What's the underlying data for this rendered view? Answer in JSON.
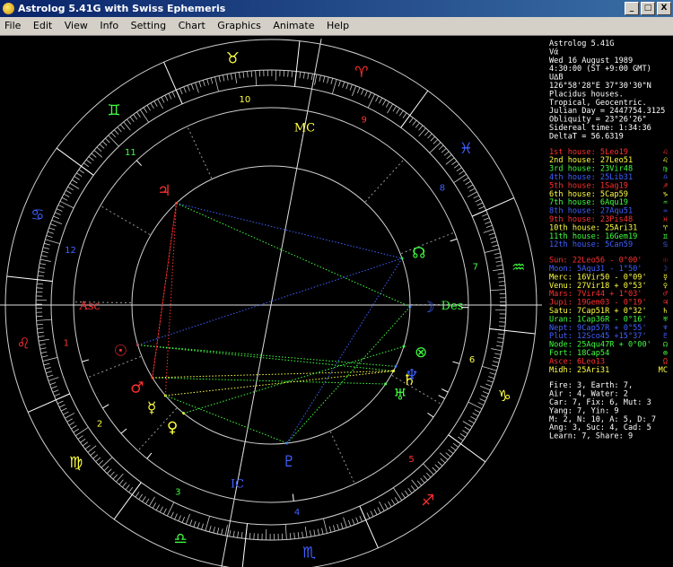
{
  "window": {
    "title": "Astrolog 5.41G with Swiss Ephemeris",
    "min_btn": "_",
    "max_btn": "□",
    "close_btn": "X"
  },
  "menu": [
    "File",
    "Edit",
    "View",
    "Info",
    "Setting",
    "Chart",
    "Graphics",
    "Animate",
    "Help"
  ],
  "info": {
    "lines": [
      {
        "text": "Astrolog 5.41G",
        "color": "#ffffff"
      },
      {
        "text": "Vά",
        "color": "#ffffff"
      },
      {
        "text": "Wed 16 August 1989",
        "color": "#ffffff"
      },
      {
        "text": "  4:30:00 (ST +9:00 GMT)",
        "color": "#ffffff"
      },
      {
        "text": "   U∆B",
        "color": "#ffffff"
      },
      {
        "text": "126°58'28\"E 37°30'30\"N",
        "color": "#ffffff"
      },
      {
        "text": "Placidus houses.",
        "color": "#ffffff"
      },
      {
        "text": "Tropical, Geocentric.",
        "color": "#ffffff"
      },
      {
        "text": "Julian Day = 2447754.3125",
        "color": "#ffffff"
      },
      {
        "text": "Obliquity = 23°26'26\"",
        "color": "#ffffff"
      },
      {
        "text": "Sidereal time:  1:34:36",
        "color": "#ffffff"
      },
      {
        "text": "DeltaT =  56.6319",
        "color": "#ffffff"
      }
    ],
    "houses": [
      {
        "text": "1st house:  5Leo19",
        "color": "#ff3030",
        "glyph": "♌"
      },
      {
        "text": "2nd house: 27Leo51",
        "color": "#ffff40",
        "glyph": "♌"
      },
      {
        "text": "3rd house: 23Vir48",
        "color": "#40ff40",
        "glyph": "♍"
      },
      {
        "text": "4th house: 25Lib31",
        "color": "#4060ff",
        "glyph": "♎"
      },
      {
        "text": "5th house:  1Sag19",
        "color": "#ff3030",
        "glyph": "♐"
      },
      {
        "text": "6th house:  5Cap59",
        "color": "#ffff40",
        "glyph": "♑"
      },
      {
        "text": "7th house:  6Aqu19",
        "color": "#40ff40",
        "glyph": "♒"
      },
      {
        "text": "8th house: 27Aqu51",
        "color": "#4060ff",
        "glyph": "♒"
      },
      {
        "text": "9th house: 23Pis48",
        "color": "#ff3030",
        "glyph": "♓"
      },
      {
        "text": "10th house: 25Ari31",
        "color": "#ffff40",
        "glyph": "♈"
      },
      {
        "text": "11th house: 16Gem19",
        "color": "#40ff40",
        "glyph": "♊"
      },
      {
        "text": "12th house:  5Can59",
        "color": "#4060ff",
        "glyph": "♋"
      }
    ],
    "planets": [
      {
        "text": "Sun: 22Leo56  - 0°00'",
        "color": "#ff3030",
        "glyph": "☉"
      },
      {
        "text": "Moon: 5Aqu31  - 1°50'",
        "color": "#4060ff",
        "glyph": "☽"
      },
      {
        "text": "Merc: 16Vir50  - 0°09'",
        "color": "#ffff40",
        "glyph": "☿"
      },
      {
        "text": "Venu: 27Vir18  + 0°53'",
        "color": "#ffff40",
        "glyph": "♀"
      },
      {
        "text": "Mars:  7Vir44  + 1°03'",
        "color": "#ff3030",
        "glyph": "♂"
      },
      {
        "text": "Jupi: 19Gem03  - 0°19'",
        "color": "#ff3030",
        "glyph": "♃"
      },
      {
        "text": "Satu:  7Cap51R + 0°32'",
        "color": "#ffff40",
        "glyph": "♄"
      },
      {
        "text": "Uran:  1Cap36R - 0°16'",
        "color": "#40ff40",
        "glyph": "♅"
      },
      {
        "text": "Nept:  9Cap57R + 0°55'",
        "color": "#4060ff",
        "glyph": "♆"
      },
      {
        "text": "Plut: 12Sco45  +15°37'",
        "color": "#4060ff",
        "glyph": "♇"
      },
      {
        "text": "Node: 25Aqu47R + 0°00'",
        "color": "#40ff40",
        "glyph": "☊"
      },
      {
        "text": "Fort: 18Cap54",
        "color": "#40ff40",
        "glyph": "⊗"
      },
      {
        "text": "Asce:  6Leo13",
        "color": "#ff3030",
        "glyph": "Ω"
      },
      {
        "text": "Midh: 25Ari31",
        "color": "#ffff40",
        "glyph": "MC"
      }
    ],
    "stats": [
      "Fire: 3, Earth: 7,",
      "Air : 4, Water: 2",
      "Car: 7, Fix: 6, Mut: 3",
      "Yang: 7, Yin: 9",
      "M: 2, N: 10, A: 5, D: 7",
      "Ang: 3, Suc: 4, Cad: 5",
      "Learn: 7, Share: 9"
    ]
  },
  "colors": {
    "red": "#ff3030",
    "yellow": "#ffff40",
    "green": "#40ff40",
    "blue": "#4060ff",
    "white": "#ffffff",
    "grey": "#a0a0a0"
  },
  "wheel": {
    "signs": [
      {
        "glyph": "♈",
        "lon": 15,
        "color": "#ff3030"
      },
      {
        "glyph": "♉",
        "lon": 45,
        "color": "#ffff40"
      },
      {
        "glyph": "♊",
        "lon": 75,
        "color": "#40ff40"
      },
      {
        "glyph": "♋",
        "lon": 105,
        "color": "#4060ff"
      },
      {
        "glyph": "♌",
        "lon": 135,
        "color": "#ff3030"
      },
      {
        "glyph": "♍",
        "lon": 165,
        "color": "#ffff40"
      },
      {
        "glyph": "♎",
        "lon": 195,
        "color": "#40ff40"
      },
      {
        "glyph": "♏",
        "lon": 225,
        "color": "#4060ff"
      },
      {
        "glyph": "♐",
        "lon": 255,
        "color": "#ff3030"
      },
      {
        "glyph": "♑",
        "lon": 285,
        "color": "#ffff40"
      },
      {
        "glyph": "♒",
        "lon": 315,
        "color": "#40ff40"
      },
      {
        "glyph": "♓",
        "lon": 345,
        "color": "#4060ff"
      }
    ],
    "houses": [
      {
        "num": "1",
        "lon": 125.3,
        "color": "#ff3030"
      },
      {
        "num": "2",
        "lon": 147.8,
        "color": "#ffff40"
      },
      {
        "num": "3",
        "lon": 173.8,
        "color": "#40ff40"
      },
      {
        "num": "4",
        "lon": 205.5,
        "color": "#4060ff"
      },
      {
        "num": "5",
        "lon": 241.3,
        "color": "#ff3030"
      },
      {
        "num": "6",
        "lon": 276.0,
        "color": "#ffff40"
      },
      {
        "num": "7",
        "lon": 306.3,
        "color": "#40ff40"
      },
      {
        "num": "8",
        "lon": 327.8,
        "color": "#4060ff"
      },
      {
        "num": "9",
        "lon": 353.8,
        "color": "#ff3030"
      },
      {
        "num": "10",
        "lon": 25.5,
        "color": "#ffff40"
      },
      {
        "num": "11",
        "lon": 61.3,
        "color": "#40ff40"
      },
      {
        "num": "12",
        "lon": 96.0,
        "color": "#4060ff"
      }
    ],
    "planets": [
      {
        "id": "sun",
        "glyph": "☉",
        "lon": 142.9,
        "color": "#ff3030"
      },
      {
        "id": "moon",
        "glyph": "☽",
        "lon": 305.5,
        "color": "#4060ff"
      },
      {
        "id": "merc",
        "glyph": "☿",
        "lon": 166.8,
        "color": "#ffff40"
      },
      {
        "id": "venu",
        "glyph": "♀",
        "lon": 177.3,
        "color": "#ffff40"
      },
      {
        "id": "mars",
        "glyph": "♂",
        "lon": 157.7,
        "color": "#ff3030"
      },
      {
        "id": "jupi",
        "glyph": "♃",
        "lon": 79.1,
        "color": "#ff3030"
      },
      {
        "id": "satu",
        "glyph": "♄",
        "lon": 277.9,
        "color": "#ffff40"
      },
      {
        "id": "uran",
        "glyph": "♅",
        "lon": 271.6,
        "color": "#40ff40"
      },
      {
        "id": "nept",
        "glyph": "♆",
        "lon": 280.0,
        "color": "#4060ff"
      },
      {
        "id": "plut",
        "glyph": "♇",
        "lon": 222.8,
        "color": "#4060ff"
      },
      {
        "id": "node",
        "glyph": "☊",
        "lon": 325.8,
        "color": "#40ff40"
      },
      {
        "id": "fort",
        "glyph": "⊗",
        "lon": 288.9,
        "color": "#40ff40"
      }
    ],
    "axes": [
      {
        "label": "Asc",
        "lon": 126.2,
        "color": "#ff3030"
      },
      {
        "label": "Des",
        "lon": 306.2,
        "color": "#40ff40"
      },
      {
        "label": "MC",
        "lon": 25.5,
        "color": "#ffff40"
      },
      {
        "label": "IC",
        "lon": 205.5,
        "color": "#4060ff"
      }
    ],
    "aspects": [
      {
        "a": "sun",
        "b": "nept",
        "color": "#40ff40"
      },
      {
        "a": "sun",
        "b": "satu",
        "color": "#40ff40"
      },
      {
        "a": "mars",
        "b": "uran",
        "color": "#40ff40"
      },
      {
        "a": "mars",
        "b": "satu",
        "color": "#ffff40"
      },
      {
        "a": "merc",
        "b": "satu",
        "color": "#ffff40"
      },
      {
        "a": "merc",
        "b": "plut",
        "color": "#40ff40"
      },
      {
        "a": "venu",
        "b": "fort",
        "color": "#40ff40"
      },
      {
        "a": "jupi",
        "b": "node",
        "color": "#4060ff"
      },
      {
        "a": "jupi",
        "b": "mars",
        "color": "#ff3030"
      },
      {
        "a": "moon",
        "b": "plut",
        "color": "#40ff40"
      },
      {
        "a": "jupi",
        "b": "moon",
        "color": "#40ff40"
      },
      {
        "a": "node",
        "b": "plut",
        "color": "#4060ff"
      },
      {
        "a": "mars",
        "b": "jupi",
        "color": "#ff3030"
      },
      {
        "a": "sun",
        "b": "node",
        "color": "#4060ff"
      },
      {
        "a": "merc",
        "b": "jupi",
        "color": "#ff3030"
      }
    ]
  }
}
